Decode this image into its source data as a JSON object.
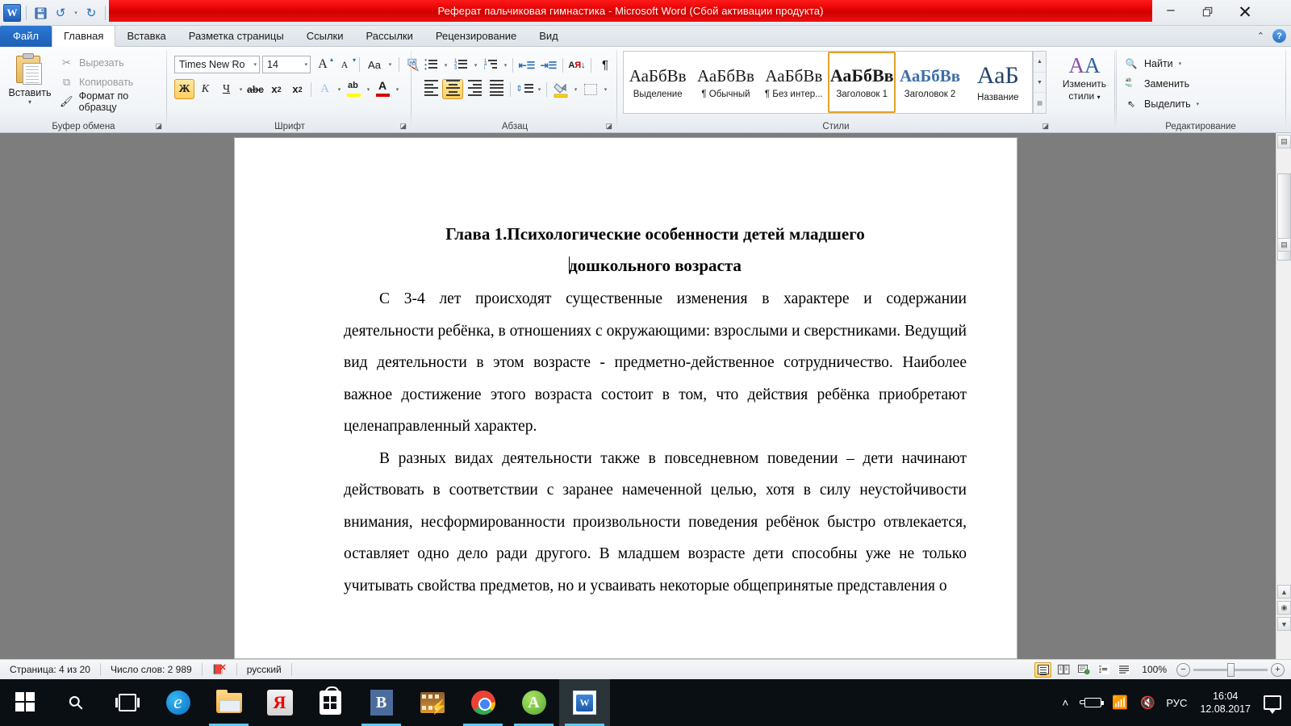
{
  "window": {
    "title": "Реферат пальчиковая гимнастика  -  Microsoft Word (Сбой активации продукта)",
    "minimize": "–",
    "restore": "❐",
    "close": "✕",
    "ribbon_collapse_icon": "collapse-ribbon-icon",
    "help": "?"
  },
  "quick_access": {
    "word_logo": "W",
    "save": "💾",
    "undo": "↺",
    "redo": "↻",
    "customize": "▾"
  },
  "tabs": [
    {
      "label": "Файл",
      "type": "file"
    },
    {
      "label": "Главная",
      "active": true
    },
    {
      "label": "Вставка",
      "active": false
    },
    {
      "label": "Разметка страницы",
      "active": false
    },
    {
      "label": "Ссылки",
      "active": false
    },
    {
      "label": "Рассылки",
      "active": false
    },
    {
      "label": "Рецензирование",
      "active": false
    },
    {
      "label": "Вид",
      "active": false
    }
  ],
  "ribbon": {
    "clipboard": {
      "group_label": "Буфер обмена",
      "paste_label": "Вставить",
      "paste_arrow": "▾",
      "cut_label": "Вырезать",
      "copy_label": "Копировать",
      "format_painter_label": "Формат по образцу",
      "dialog_launcher": "◪"
    },
    "font": {
      "group_label": "Шрифт",
      "font_name": "Times New Ro",
      "font_size": "14",
      "grow_font": "A",
      "shrink_font": "A",
      "change_case": "Aa",
      "clear_formatting": "A",
      "bold": "Ж",
      "italic": "К",
      "underline": "Ч",
      "strikethrough": "abc",
      "subscript": "x",
      "superscript": "x",
      "text_effects": "A",
      "highlight": "ab",
      "font_color": "A",
      "dialog_launcher": "◪"
    },
    "paragraph": {
      "group_label": "Абзац",
      "bullets": "bullets-icon",
      "numbering": "numbering-icon",
      "multilevel": "multilevel-list-icon",
      "decrease_indent": "decrease-indent-icon",
      "increase_indent": "increase-indent-icon",
      "sort": "АЯ",
      "show_marks": "¶",
      "align_left": "align-left-icon",
      "align_center": "align-center-icon",
      "align_right": "align-right-icon",
      "justify": "justify-icon",
      "line_spacing": "line-spacing-icon",
      "shading": "shading-icon",
      "borders": "borders-icon",
      "dialog_launcher": "◪"
    },
    "styles": {
      "group_label": "Стили",
      "items": [
        {
          "sample": "АаБбВв",
          "name": "Выделение",
          "selected": false
        },
        {
          "sample": "АаБбВв",
          "name": "¶ Обычный",
          "selected": false
        },
        {
          "sample": "АаБбВв",
          "name": "¶ Без интер...",
          "selected": false
        },
        {
          "sample": "АаБбВв",
          "name": "Заголовок 1",
          "selected": true
        },
        {
          "sample": "АаБбВв",
          "name": "Заголовок 2",
          "selected": false
        },
        {
          "sample": "АаБ",
          "name": "Название",
          "selected": false
        }
      ],
      "scroll_up": "▲",
      "scroll_down": "▼",
      "more": "▤",
      "dialog_launcher": "◪"
    },
    "change_styles": {
      "label_line1": "Изменить",
      "label_line2": "стили",
      "arrow": "▾"
    },
    "editing": {
      "group_label": "Редактирование",
      "find_label": "Найти",
      "find_arrow": "▾",
      "replace_label": "Заменить",
      "select_label": "Выделить",
      "select_arrow": "▾"
    }
  },
  "document": {
    "heading_line1": "Глава 1.Психологические особенности детей младшего",
    "heading_line2": "дошкольного возраста",
    "paragraph1": "С 3-4 лет происходят существенные изменения в характере и содержании деятельности ребёнка, в отношениях с окружающими: взрослыми и сверстниками. Ведущий вид деятельности в этом возрасте - предметно-действенное сотрудничество. Наиболее важное достижение этого возраста состоит в том, что действия ребёнка приобретают целенаправленный характер.",
    "paragraph2": "В разных  видах деятельности также в повседневном поведении – дети начинают действовать в соответствии с заранее намеченной целью, хотя в силу неустойчивости внимания, несформированности произвольности поведения ребёнок быстро отвлекается, оставляет одно дело ради другого. В младшем возрасте дети  способны уже не только учитывать свойства предметов, но и усваивать некоторые общепринятые представления о"
  },
  "status_bar": {
    "page": "Страница: 4 из 20",
    "words": "Число слов: 2 989",
    "proofing_icon": "proofing-errors-icon",
    "language": "русский",
    "view_print_layout": "print-layout-icon",
    "view_fullscreen": "fullscreen-reading-icon",
    "view_web": "web-layout-icon",
    "view_outline": "outline-icon",
    "view_draft": "draft-icon",
    "zoom_level": "100%",
    "zoom_out": "−",
    "zoom_in": "+"
  },
  "taskbar": {
    "items": [
      {
        "name": "start-button",
        "icon": "windows-logo"
      },
      {
        "name": "search-button",
        "icon": "magnifier"
      },
      {
        "name": "task-view-button",
        "icon": "task-view"
      },
      {
        "name": "edge-button",
        "icon": "edge",
        "glyph": "e",
        "running": false
      },
      {
        "name": "file-explorer-button",
        "icon": "folder",
        "running": true
      },
      {
        "name": "yandex-browser-button",
        "icon": "yandex",
        "glyph": "Я",
        "running": false
      },
      {
        "name": "store-button",
        "icon": "store",
        "running": false
      },
      {
        "name": "vk-button",
        "icon": "vk",
        "glyph": "B",
        "running": true
      },
      {
        "name": "movie-maker-button",
        "icon": "movie-maker",
        "running": false
      },
      {
        "name": "chrome-button",
        "icon": "chrome",
        "running": true
      },
      {
        "name": "avast-button",
        "icon": "avast",
        "glyph": "A",
        "running": true
      },
      {
        "name": "word-button",
        "icon": "word",
        "glyph": "W",
        "running": true,
        "active": true
      }
    ],
    "tray": {
      "show_hidden": "˄",
      "battery": "battery-charging-icon",
      "network": "wifi-icon",
      "volume": "volume-muted-icon",
      "language": "РУС",
      "time": "16:04",
      "date": "12.08.2017",
      "action_center": "notifications-icon"
    }
  }
}
